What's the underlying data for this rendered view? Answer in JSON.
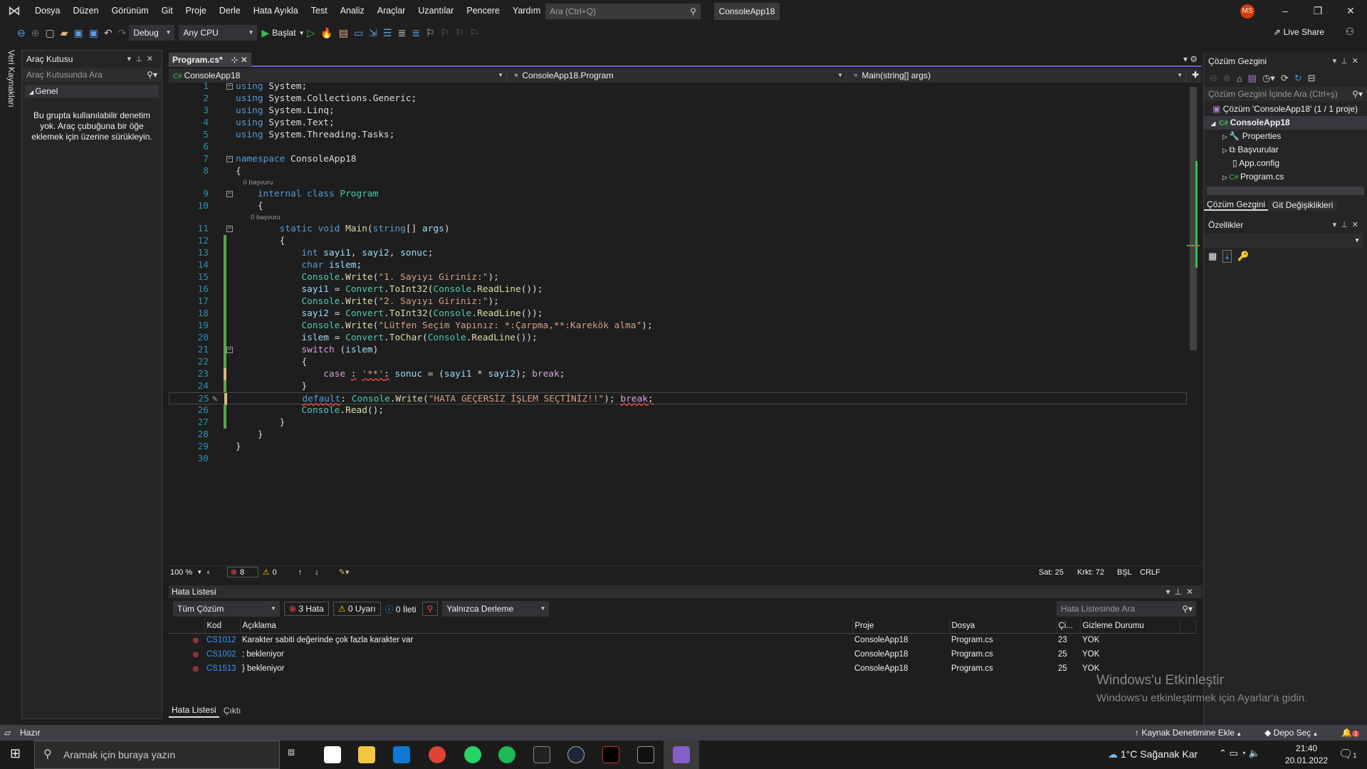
{
  "menu": {
    "items": [
      "Dosya",
      "Düzen",
      "Görünüm",
      "Git",
      "Proje",
      "Derle",
      "Hata Ayıkla",
      "Test",
      "Analiz",
      "Araçlar",
      "Uzantılar",
      "Pencere",
      "Yardım"
    ],
    "search_placeholder": "Ara (Ctrl+Q)",
    "solution_title": "ConsoleApp18",
    "avatar": "MS"
  },
  "toolbar": {
    "config": "Debug",
    "platform": "Any CPU",
    "start": "Başlat",
    "live_share": "Live Share"
  },
  "left_strip": {
    "label": "Veri Kaynakları"
  },
  "toolbox": {
    "title": "Araç Kutusu",
    "search": "Araç Kutusunda Ara",
    "group": "Genel",
    "message": "Bu grupta kullanılabilir denetim yok. Araç çubuğuna bir öğe eklemek için üzerine sürükleyin."
  },
  "editor": {
    "tab": "Program.cs*",
    "nav": {
      "project": "ConsoleApp18",
      "type": "ConsoleApp18.Program",
      "member": "Main(string[] args)"
    },
    "lines": [
      {
        "n": 1,
        "fold": true,
        "t": [
          [
            "using",
            "k"
          ],
          [
            " System;",
            "p"
          ]
        ]
      },
      {
        "n": 2,
        "t": [
          [
            "using",
            "k"
          ],
          [
            " System.Collections.Generic;",
            "p"
          ]
        ]
      },
      {
        "n": 3,
        "t": [
          [
            "using",
            "k"
          ],
          [
            " System.Linq;",
            "p"
          ]
        ]
      },
      {
        "n": 4,
        "t": [
          [
            "using",
            "k"
          ],
          [
            " System.Text;",
            "p"
          ]
        ]
      },
      {
        "n": 5,
        "t": [
          [
            "using",
            "k"
          ],
          [
            " System.Threading.Tasks;",
            "p"
          ]
        ]
      },
      {
        "n": 6,
        "t": []
      },
      {
        "n": 7,
        "fold": true,
        "t": [
          [
            "namespace",
            "k"
          ],
          [
            " ConsoleApp18",
            "p"
          ]
        ]
      },
      {
        "n": 8,
        "t": [
          [
            "{",
            "p"
          ]
        ]
      },
      {
        "lens": "    0 başvuru"
      },
      {
        "n": 9,
        "fold": true,
        "t": [
          [
            "    internal class ",
            "k"
          ],
          [
            "Program",
            "t"
          ]
        ]
      },
      {
        "n": 10,
        "t": [
          [
            "    {",
            "p"
          ]
        ]
      },
      {
        "lens": "        0 başvuru"
      },
      {
        "n": 11,
        "fold": true,
        "t": [
          [
            "        static void ",
            "k"
          ],
          [
            "Main",
            "m"
          ],
          [
            "(",
            "p"
          ],
          [
            "string",
            "k"
          ],
          [
            "[] ",
            "p"
          ],
          [
            "args",
            "v"
          ],
          [
            ")",
            "p"
          ]
        ]
      },
      {
        "n": 12,
        "chg": "g",
        "t": [
          [
            "        {",
            "p"
          ]
        ]
      },
      {
        "n": 13,
        "chg": "g",
        "t": [
          [
            "            int ",
            "k"
          ],
          [
            "sayi1",
            "v"
          ],
          [
            ", ",
            "p"
          ],
          [
            "sayi2",
            "v"
          ],
          [
            ", ",
            "p"
          ],
          [
            "sonuc",
            "v"
          ],
          [
            ";",
            "p"
          ]
        ]
      },
      {
        "n": 14,
        "chg": "g",
        "t": [
          [
            "            char ",
            "k"
          ],
          [
            "islem",
            "v"
          ],
          [
            ";",
            "p"
          ]
        ]
      },
      {
        "n": 15,
        "chg": "g",
        "t": [
          [
            "            ",
            "p"
          ],
          [
            "Console",
            "t"
          ],
          [
            ".",
            "p"
          ],
          [
            "Write",
            "m"
          ],
          [
            "(",
            "p"
          ],
          [
            "\"1. Sayıyı Giriniz:\"",
            "s"
          ],
          [
            ");",
            "p"
          ]
        ]
      },
      {
        "n": 16,
        "chg": "g",
        "t": [
          [
            "            sayi1",
            "v"
          ],
          [
            " = ",
            "p"
          ],
          [
            "Convert",
            "t"
          ],
          [
            ".",
            "p"
          ],
          [
            "ToInt32",
            "m"
          ],
          [
            "(",
            "p"
          ],
          [
            "Console",
            "t"
          ],
          [
            ".",
            "p"
          ],
          [
            "ReadLine",
            "m"
          ],
          [
            "());",
            "p"
          ]
        ]
      },
      {
        "n": 17,
        "chg": "g",
        "t": [
          [
            "            ",
            "p"
          ],
          [
            "Console",
            "t"
          ],
          [
            ".",
            "p"
          ],
          [
            "Write",
            "m"
          ],
          [
            "(",
            "p"
          ],
          [
            "\"2. Sayıyı Giriniz:\"",
            "s"
          ],
          [
            ");",
            "p"
          ]
        ]
      },
      {
        "n": 18,
        "chg": "g",
        "t": [
          [
            "            sayi2",
            "v"
          ],
          [
            " = ",
            "p"
          ],
          [
            "Convert",
            "t"
          ],
          [
            ".",
            "p"
          ],
          [
            "ToInt32",
            "m"
          ],
          [
            "(",
            "p"
          ],
          [
            "Console",
            "t"
          ],
          [
            ".",
            "p"
          ],
          [
            "ReadLine",
            "m"
          ],
          [
            "());",
            "p"
          ]
        ]
      },
      {
        "n": 19,
        "chg": "g",
        "t": [
          [
            "            ",
            "p"
          ],
          [
            "Console",
            "t"
          ],
          [
            ".",
            "p"
          ],
          [
            "Write",
            "m"
          ],
          [
            "(",
            "p"
          ],
          [
            "\"Lütfen Seçim Yapınız: *:Çarpma,**:Karekök alma\"",
            "s"
          ],
          [
            ");",
            "p"
          ]
        ]
      },
      {
        "n": 20,
        "chg": "g",
        "t": [
          [
            "            islem",
            "v"
          ],
          [
            " = ",
            "p"
          ],
          [
            "Convert",
            "t"
          ],
          [
            ".",
            "p"
          ],
          [
            "ToChar",
            "m"
          ],
          [
            "(",
            "p"
          ],
          [
            "Console",
            "t"
          ],
          [
            ".",
            "p"
          ],
          [
            "ReadLine",
            "m"
          ],
          [
            "());",
            "p"
          ]
        ]
      },
      {
        "n": 21,
        "chg": "g",
        "fold": true,
        "t": [
          [
            "            switch",
            "c"
          ],
          [
            " (",
            "p"
          ],
          [
            "islem",
            "v"
          ],
          [
            ")",
            "p"
          ]
        ]
      },
      {
        "n": 22,
        "chg": "g",
        "t": [
          [
            "            {",
            "p"
          ]
        ]
      },
      {
        "n": 23,
        "chg": "y",
        "t": [
          [
            "                case",
            "c"
          ],
          [
            " ",
            "p"
          ],
          [
            ":",
            "pe"
          ],
          [
            " ",
            "p"
          ],
          [
            "'**'",
            "se"
          ],
          [
            ":",
            "pe"
          ],
          [
            " ",
            "p"
          ],
          [
            "sonuc",
            "v"
          ],
          [
            " = (",
            "p"
          ],
          [
            "sayi1",
            "v"
          ],
          [
            " * ",
            "p"
          ],
          [
            "sayi2",
            "v"
          ],
          [
            "); ",
            "p"
          ],
          [
            "break",
            "c"
          ],
          [
            ";",
            "p"
          ]
        ]
      },
      {
        "n": 24,
        "chg": "g",
        "t": [
          [
            "            }",
            "p"
          ]
        ]
      },
      {
        "n": 25,
        "chg": "y",
        "cur": true,
        "t": [
          [
            "            ",
            "p"
          ],
          [
            "default",
            "ke"
          ],
          [
            ": ",
            "p"
          ],
          [
            "Console",
            "t"
          ],
          [
            ".",
            "p"
          ],
          [
            "Write",
            "m"
          ],
          [
            "(",
            "p"
          ],
          [
            "\"HATA GEÇERSİZ İŞLEM SEÇTİNİZ!!\"",
            "s"
          ],
          [
            "); ",
            "p"
          ],
          [
            "break",
            "ce"
          ],
          [
            ";",
            "pe"
          ]
        ]
      },
      {
        "n": 26,
        "chg": "g",
        "t": [
          [
            "            ",
            "p"
          ],
          [
            "Console",
            "t"
          ],
          [
            ".",
            "p"
          ],
          [
            "Read",
            "m"
          ],
          [
            "();",
            "p"
          ]
        ]
      },
      {
        "n": 27,
        "chg": "g",
        "t": [
          [
            "        }",
            "p"
          ]
        ]
      },
      {
        "n": 28,
        "t": [
          [
            "    }",
            "p"
          ]
        ]
      },
      {
        "n": 29,
        "t": [
          [
            "}",
            "p"
          ]
        ]
      },
      {
        "n": 30,
        "t": []
      }
    ],
    "status": {
      "zoom": "100 %",
      "errors": "8",
      "warnings": "0",
      "line": "Sat: 25",
      "col": "Krkt: 72",
      "ins": "BŞL",
      "eol": "CRLF"
    }
  },
  "error_list": {
    "title": "Hata Listesi",
    "scope": "Tüm Çözüm",
    "errors": "3 Hata",
    "warnings": "0 Uyarı",
    "messages": "0 İleti",
    "build_filter": "Yalnızca Derleme",
    "search": "Hata Listesinde Ara",
    "columns": [
      "Kod",
      "Açıklama",
      "Proje",
      "Dosya",
      "Çi...",
      "Gizleme Durumu"
    ],
    "rows": [
      [
        "CS1012",
        "Karakter sabiti değerinde çok fazla karakter var",
        "ConsoleApp18",
        "Program.cs",
        "23",
        "YOK"
      ],
      [
        "CS1002",
        "; bekleniyor",
        "ConsoleApp18",
        "Program.cs",
        "25",
        "YOK"
      ],
      [
        "CS1513",
        "} bekleniyor",
        "ConsoleApp18",
        "Program.cs",
        "25",
        "YOK"
      ]
    ],
    "tabs": [
      "Hata Listesi",
      "Çıktı"
    ]
  },
  "solution_explorer": {
    "title": "Çözüm Gezgini",
    "search": "Çözüm Gezgini İçinde Ara (Ctrl+ş)",
    "solution": "Çözüm 'ConsoleApp18' (1 / 1 proje)",
    "project": "ConsoleApp18",
    "items": [
      "Properties",
      "Başvurular",
      "App.config",
      "Program.cs"
    ],
    "tabs": [
      "Çözüm Gezgini",
      "Git Değişiklikleri"
    ]
  },
  "properties": {
    "title": "Özellikler"
  },
  "watermark": {
    "title": "Windows'u Etkinleştir",
    "sub": "Windows'u etkinleştirmek için Ayarlar'a gidin."
  },
  "statusbar": {
    "ready": "Hazır",
    "source_control": "Kaynak Denetimine Ekle",
    "repo": "Depo Seç",
    "notifications": "1"
  },
  "taskbar": {
    "search": "Aramak için buraya yazın",
    "weather": "1°C  Sağanak Kar",
    "time": "21:40",
    "date": "20.01.2022",
    "action_center": "1"
  }
}
